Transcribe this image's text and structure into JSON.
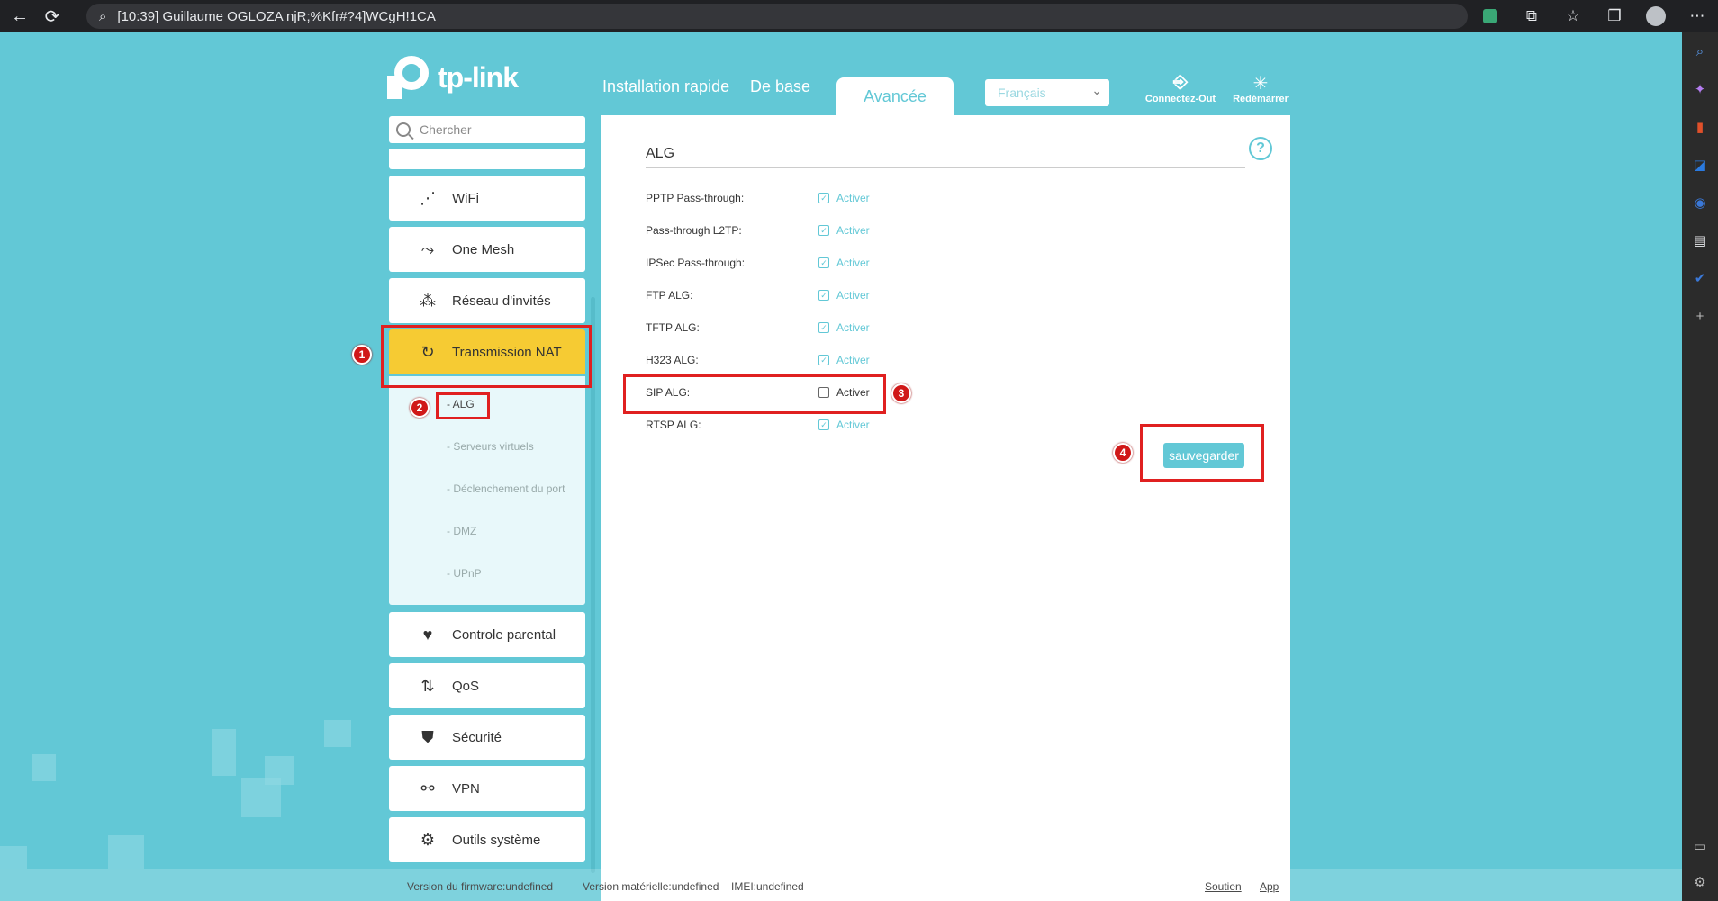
{
  "browser": {
    "url_text": "[10:39] Guillaume OGLOZA njR;%Kfr#?4]WCgH!1CA"
  },
  "brand": {
    "logo_text": "tp-link"
  },
  "top_nav": {
    "tabs": [
      {
        "label": "Installation rapide"
      },
      {
        "label": "De base"
      },
      {
        "label": "Avancée",
        "active": true
      }
    ],
    "language": "Français",
    "logout_label": "Connectez-Out",
    "reboot_label": "Redémarrer"
  },
  "sidebar": {
    "search_placeholder": "Chercher",
    "items": [
      {
        "label": "WiFi",
        "icon": "wifi-icon"
      },
      {
        "label": "One Mesh",
        "icon": "mesh-icon"
      },
      {
        "label": "Réseau d'invités",
        "icon": "guest-network-icon"
      },
      {
        "label": "Transmission NAT",
        "icon": "nat-forwarding-icon",
        "active": true
      },
      {
        "label": "Controle parental",
        "icon": "heart-icon"
      },
      {
        "label": "QoS",
        "icon": "qos-arrows-icon"
      },
      {
        "label": "Sécurité",
        "icon": "shield-icon"
      },
      {
        "label": "VPN",
        "icon": "link-icon"
      },
      {
        "label": "Outils système",
        "icon": "gear-icon"
      }
    ],
    "nat_sub_items": [
      {
        "label": "- ALG",
        "selected": true
      },
      {
        "label": "- Serveurs virtuels"
      },
      {
        "label": "- Déclenchement du port"
      },
      {
        "label": "- DMZ"
      },
      {
        "label": "- UPnP"
      }
    ]
  },
  "alg_panel": {
    "title": "ALG",
    "help": "?",
    "rows": [
      {
        "label": "PPTP Pass-through:",
        "checked": true,
        "option": "Activer"
      },
      {
        "label": "Pass-through L2TP:",
        "checked": true,
        "option": "Activer"
      },
      {
        "label": "IPSec Pass-through:",
        "checked": true,
        "option": "Activer"
      },
      {
        "label": "FTP ALG:",
        "checked": true,
        "option": "Activer"
      },
      {
        "label": "TFTP ALG:",
        "checked": true,
        "option": "Activer"
      },
      {
        "label": "H323 ALG:",
        "checked": true,
        "option": "Activer"
      },
      {
        "label": "SIP ALG:",
        "checked": false,
        "option": "Activer"
      },
      {
        "label": "RTSP ALG:",
        "checked": true,
        "option": "Activer"
      }
    ],
    "save_label": "sauvegarder"
  },
  "annotations": {
    "b1": "1",
    "b2": "2",
    "b3": "3",
    "b4": "4"
  },
  "footer": {
    "firmware": "Version du firmware:undefined",
    "hardware": "Version matérielle:undefined",
    "imei": "IMEI:undefined",
    "support": "Soutien",
    "app": "App"
  },
  "colors": {
    "background": "#62c8d6",
    "accent": "#62c8d6",
    "active_menu": "#f6cb33",
    "annotation": "#e02020"
  }
}
